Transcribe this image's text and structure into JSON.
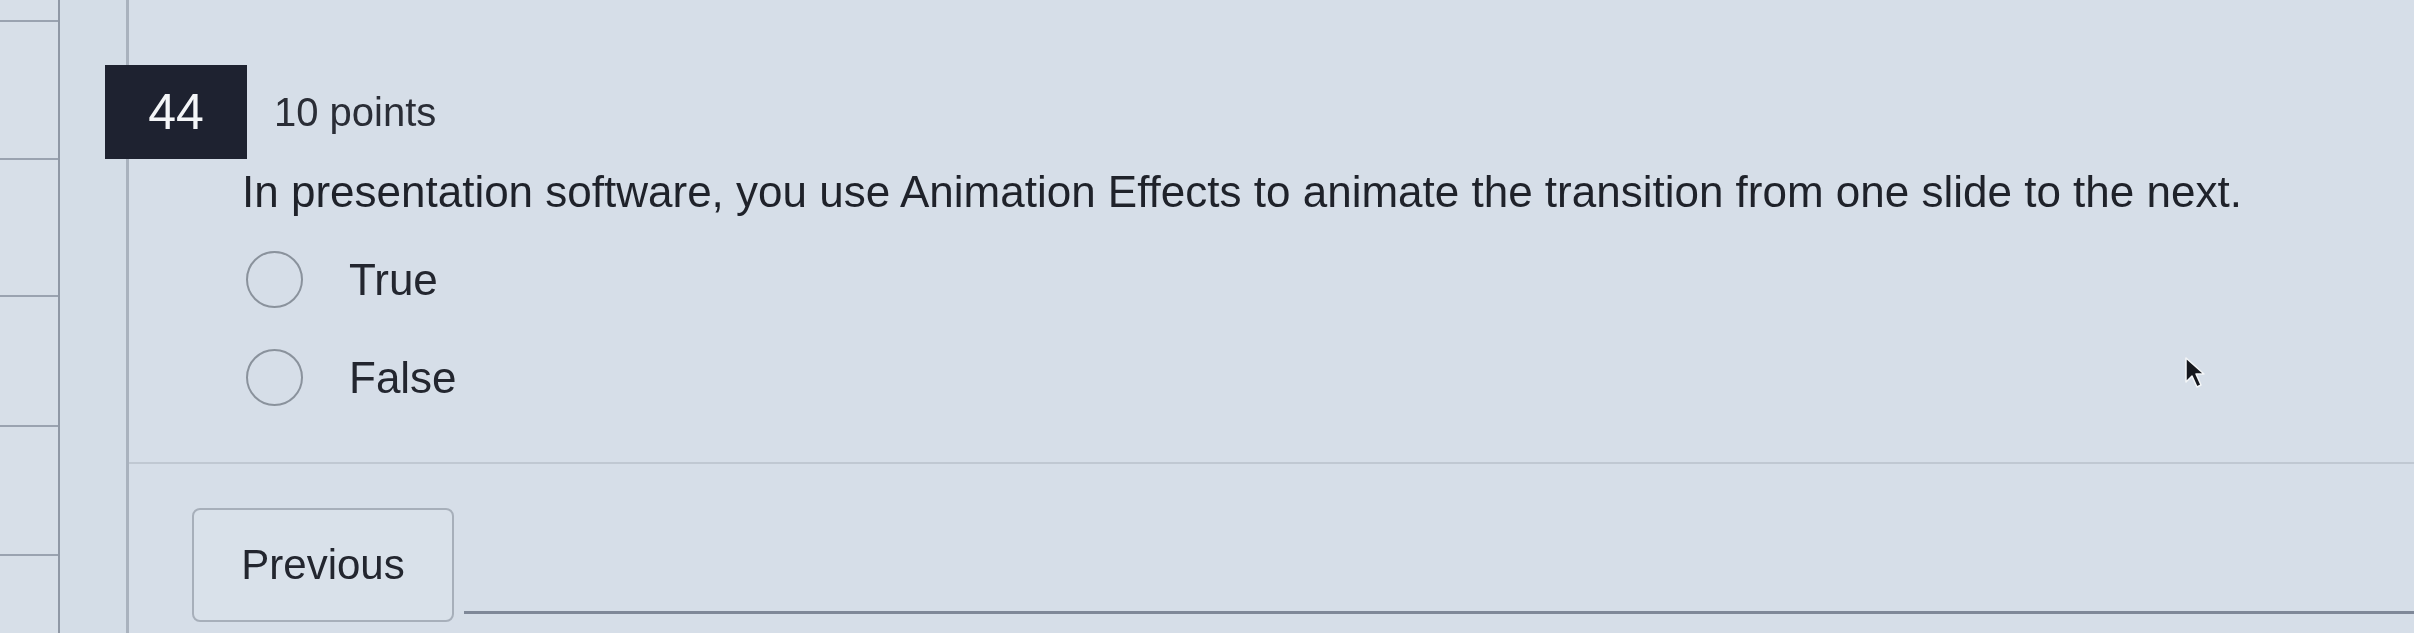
{
  "question": {
    "number": "44",
    "points": "10 points",
    "text": "In presentation software, you use Animation Effects to animate the transition from one slide to the next."
  },
  "options": [
    {
      "label": "True",
      "selected": false
    },
    {
      "label": "False",
      "selected": false
    }
  ],
  "navigation": {
    "previous_button": "Previous"
  }
}
